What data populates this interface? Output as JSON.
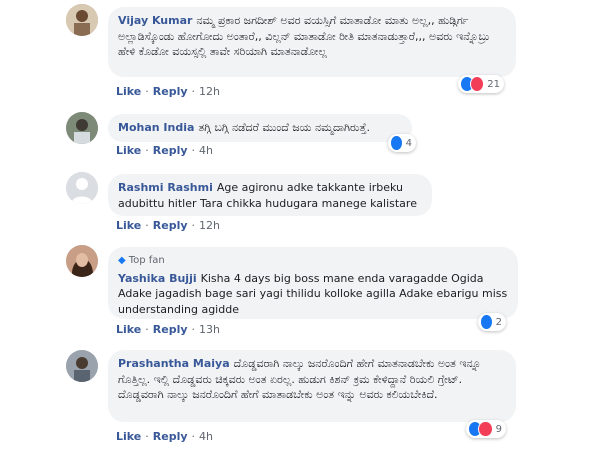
{
  "comments": [
    {
      "author": "Vijay Kumar",
      "text": "ನಮ್ಮ ಪ್ರಕಾರ ಜಗದೀಶ್ ಅವರ ವಯಸ್ಸಿಗೆ ಮಾತಾಡೋ ಮಾತು ಅಲ್ಲ,, ಹುಡ್ಗಿರ್ಗ ಅಲ್ಲಾಡಿಸ್ಕೊಂಡು ಹೋಗೋದು ಅಂತಾರೆ,, ವಿಲ್ಲನ್ ಮಾತಾಡೋ ರೀತಿ ಮಾತನಾಡುತ್ತಾರೆ,,, ಅವರು ಇನ್ನೊಬ್ರು ಹೇಳಿ ಕೊಡೋ ವಯಸ್ಸಲ್ಲಿ ತಾವೇ ಸರಿಯಾಗಿ ಮಾತನಾಡೋಲ್ಲ",
      "like": "Like",
      "reply": "Reply",
      "time": "12h",
      "reactions": "21"
    },
    {
      "author": "Mohan India",
      "text": "ತಗ್ಗಿ ಬಗ್ಗಿ ನಡೆದರೆ ಮುಂದೆ ಜಯ ನಮ್ಮದಾಗಿರುತ್ತೆ.",
      "like": "Like",
      "reply": "Reply",
      "time": "4h",
      "reactions": "4"
    },
    {
      "author": "Rashmi Rashmi",
      "text": "Age agironu adke takkante irbeku adubittu hitler Tara chikka hudugara manege kalistare",
      "like": "Like",
      "reply": "Reply",
      "time": "12h"
    },
    {
      "badge": "Top fan",
      "author": "Yashika Bujji",
      "text": "Kisha 4 days big boss mane enda varagadde Ogida Adake jagadish bage sari yagi thilidu kolloke agilla Adake ebarigu miss understanding agidde",
      "like": "Like",
      "reply": "Reply",
      "time": "13h",
      "reactions": "2"
    },
    {
      "author": "Prashantha Maiya",
      "text": "ದೊಡ್ಡವರಾಗಿ ನಾಲ್ಕು ಜನರೊಂದಿಗೆ ಹೇಗೆ ಮಾತನಾಡಬೇಕು ಅಂತ ಇನ್ನೂ ಗೊತ್ತಿಲ್ಲ. ಇಲ್ಲಿ ದೊಡ್ಡವರು ಚಿಕ್ಕವರು ಅಂತ ಏರಲ್ಲ. ಹುಡುಗ ಕಿಶನ್ ಕ್ರಮ ಕೇಳಿದ್ದಾನೆ ರಿಯಲಿ ಗ್ರೇಟ್. ದೊಡ್ಡವರಾಗಿ ನಾಲ್ಕು ಜನರೊಂದಿಗೆ ಹೇಗೆ ಮಾತಾಡಬೇಕು ಅಂತ ಇನ್ನು ಅವರು ಕಲಿಯಬೇಕಿದೆ.",
      "like": "Like",
      "reply": "Reply",
      "time": "4h",
      "reactions": "9"
    }
  ],
  "colors": {
    "author": "#385898",
    "bubble": "#f2f3f5",
    "like_reaction": "#1877f2",
    "love_reaction": "#f33e58"
  }
}
